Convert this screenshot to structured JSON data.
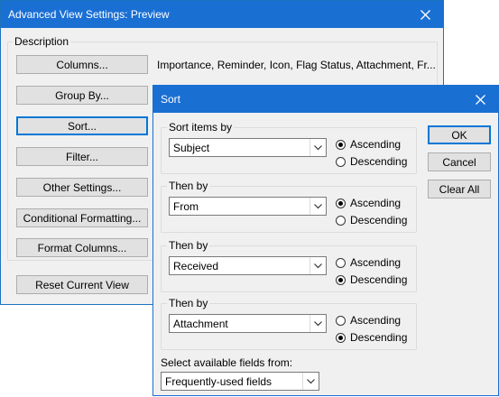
{
  "main_dialog": {
    "title": "Advanced View Settings: Preview",
    "description_label": "Description",
    "buttons": {
      "columns": "Columns...",
      "group_by": "Group By...",
      "sort": "Sort...",
      "filter": "Filter...",
      "other_settings": "Other Settings...",
      "conditional_formatting": "Conditional Formatting...",
      "format_columns": "Format Columns...",
      "reset_current_view": "Reset Current View"
    },
    "columns_value": "Importance, Reminder, Icon, Flag Status, Attachment, Fr..."
  },
  "sort_dialog": {
    "title": "Sort",
    "groups": [
      {
        "label": "Sort items by",
        "field": "Subject",
        "ascending": true
      },
      {
        "label": "Then by",
        "field": "From",
        "ascending": true
      },
      {
        "label": "Then by",
        "field": "Received",
        "ascending": false
      },
      {
        "label": "Then by",
        "field": "Attachment",
        "ascending": false
      }
    ],
    "ascending_label": "Ascending",
    "descending_label": "Descending",
    "buttons": {
      "ok": "OK",
      "cancel": "Cancel",
      "clear_all": "Clear All"
    },
    "fields_from_label": "Select available fields from:",
    "fields_from_value": "Frequently-used fields"
  }
}
